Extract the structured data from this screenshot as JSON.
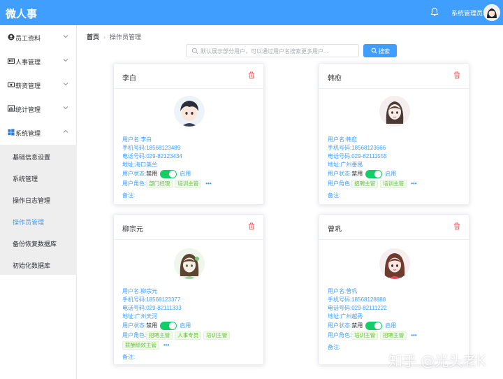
{
  "header": {
    "title": "微人事",
    "user": "系统管理员",
    "accent": "#409eff"
  },
  "sidebar": {
    "menus": [
      {
        "label": "员工资料",
        "icon": "user-circle-icon"
      },
      {
        "label": "人事管理",
        "icon": "id-card-icon"
      },
      {
        "label": "薪资管理",
        "icon": "money-icon"
      },
      {
        "label": "统计管理",
        "icon": "bar-chart-icon"
      },
      {
        "label": "系统管理",
        "icon": "windows-icon"
      }
    ],
    "subitems": [
      "基础信息设置",
      "系统管理",
      "操作日志管理",
      "操作员管理",
      "备份恢复数据库",
      "初始化数据库"
    ]
  },
  "breadcrumb": {
    "home": "首页",
    "current": "操作员管理"
  },
  "search": {
    "placeholder": "默认展示部分用户，可以通过用户名搜索更多用户...",
    "button": "搜索"
  },
  "labels": {
    "username": "用户名:",
    "phone": "手机号码:",
    "tel": "电话号码:",
    "address": "地址:",
    "status": "用户状态:",
    "disabled": "禁用",
    "enabled": "启用",
    "roles": "用户角色:",
    "remark": "备注:",
    "more": "•••"
  },
  "cards": [
    {
      "name": "李白",
      "username": "李白",
      "phone": "18568123489",
      "tel": "029-82123434",
      "address": "海口美兰",
      "roles": [
        "部门经理",
        "培训主管"
      ]
    },
    {
      "name": "韩愈",
      "username": "韩愈",
      "phone": "18568123666",
      "tel": "029-82111555",
      "address": "广州番禺",
      "roles": [
        "招聘主管",
        "培训主管"
      ]
    },
    {
      "name": "柳宗元",
      "username": "柳宗元",
      "phone": "18568123377",
      "tel": "029-82111333",
      "address": "广州天河",
      "roles": [
        "招聘主管",
        "人事专员",
        "培训主管",
        "薪酬绩效主管"
      ]
    },
    {
      "name": "曾巩",
      "username": "曾巩",
      "phone": "18568128888",
      "tel": "029-82111222",
      "address": "广州越秀",
      "roles": [
        "培训主管",
        "招聘主管"
      ]
    }
  ],
  "watermark": "知乎 @光头老K"
}
